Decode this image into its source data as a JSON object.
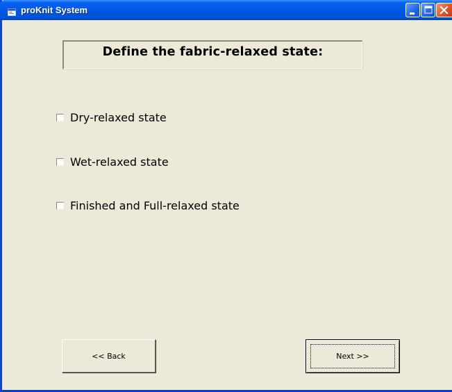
{
  "window": {
    "title": "proKnit System",
    "app_icon": "app-window-icon",
    "controls": [
      "minimize-icon",
      "maximize-icon",
      "close-icon"
    ]
  },
  "form": {
    "heading": "Define the fabric-relaxed state:",
    "options": [
      {
        "label": "Dry-relaxed state",
        "checked": false
      },
      {
        "label": "Wet-relaxed state",
        "checked": false
      },
      {
        "label": "Finished and Full-relaxed state",
        "checked": false
      }
    ]
  },
  "buttons": {
    "back_label": "<< Back",
    "next_label": "Next >>"
  },
  "colors": {
    "titlebar": "#0058e6",
    "window_background": "#ece9d8",
    "close_button": "#e0552a"
  }
}
